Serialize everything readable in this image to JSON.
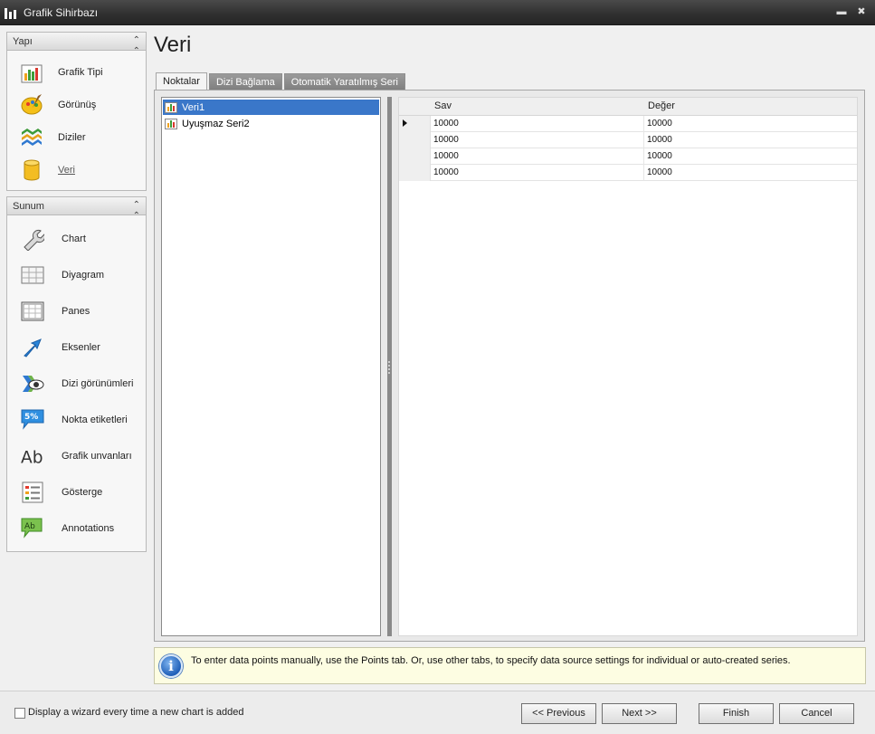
{
  "window": {
    "title": "Grafik Sihirbazı"
  },
  "nav": {
    "structure": {
      "header": "Yapı",
      "items": [
        {
          "label": "Grafik Tipi",
          "icon": "chart-type-icon"
        },
        {
          "label": "Görünüş",
          "icon": "appearance-palette-icon"
        },
        {
          "label": "Diziler",
          "icon": "series-layers-icon"
        },
        {
          "label": "Veri",
          "icon": "data-cylinder-icon"
        }
      ]
    },
    "presentation": {
      "header": "Sunum",
      "items": [
        {
          "label": "Chart",
          "icon": "wrench-icon"
        },
        {
          "label": "Diyagram",
          "icon": "diagram-grid-icon"
        },
        {
          "label": "Panes",
          "icon": "panes-icon"
        },
        {
          "label": "Eksenler",
          "icon": "axes-arrow-icon"
        },
        {
          "label": "Dizi görünümleri",
          "icon": "series-view-eye-icon"
        },
        {
          "label": "Nokta etiketleri",
          "icon": "point-labels-icon"
        },
        {
          "label": "Grafik unvanları",
          "icon": "chart-titles-ab-icon"
        },
        {
          "label": "Gösterge",
          "icon": "legend-icon"
        },
        {
          "label": "Annotations",
          "icon": "annotations-icon"
        }
      ]
    }
  },
  "page": {
    "title": "Veri"
  },
  "tabs": [
    "Noktalar",
    "Dizi Bağlama",
    "Otomatik Yaratılmış Seri"
  ],
  "series": [
    "Veri1",
    "Uyuşmaz Seri2"
  ],
  "grid": {
    "columns": [
      "Sav",
      "Değer"
    ],
    "rows": [
      [
        "10000",
        "10000"
      ],
      [
        "10000",
        "10000"
      ],
      [
        "10000",
        "10000"
      ],
      [
        "10000",
        "10000"
      ]
    ]
  },
  "info": {
    "text": "To enter data points manually, use the Points tab. Or, use other tabs, to specify data source settings for individual or auto-created series."
  },
  "footer": {
    "checkbox_label": "Display a wizard every time a new chart is added",
    "buttons": {
      "previous": "<< Previous",
      "next": "Next >>",
      "finish": "Finish",
      "cancel": "Cancel"
    }
  }
}
